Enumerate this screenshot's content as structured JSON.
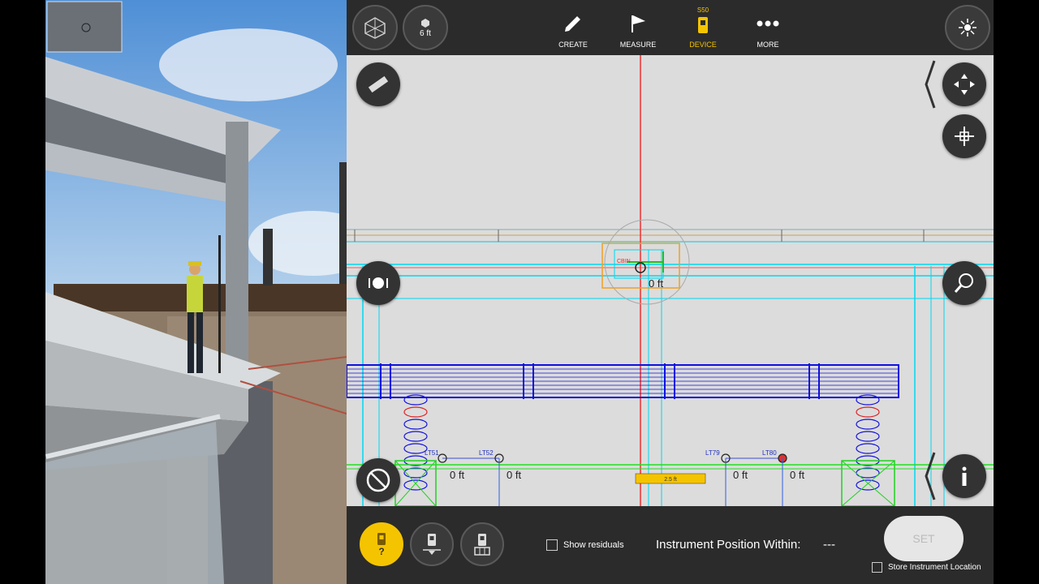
{
  "toolbar": {
    "scale_label": "6 ft",
    "create_label": "CREATE",
    "measure_label": "MEASURE",
    "device_label": "DEVICE",
    "device_badge": "S50",
    "more_label": "MORE",
    "accent_color": "#f5c400"
  },
  "canvas": {
    "center_offset_label": "0 ft",
    "offsets": [
      "0 ft",
      "0 ft",
      "0 ft",
      "0 ft"
    ],
    "scale_bar_label": "2.5 ft",
    "center_point_label": "CBIN",
    "point_labels": [
      "LT51",
      "LT52",
      "LT79",
      "LT80"
    ]
  },
  "bottom": {
    "show_residuals_label": "Show residuals",
    "instrument_position_label": "Instrument Position Within:",
    "instrument_position_value": "---",
    "set_label": "SET",
    "store_location_label": "Store Instrument Location",
    "device_help_mark": "?"
  },
  "icons": {
    "view_cube": "cube-icon",
    "ruler": "ruler-icon",
    "pan": "pan-arrows-icon",
    "zoom_extents": "crosshair-arrows-icon",
    "zoom": "magnifier-icon",
    "info": "info-icon",
    "cancel": "no-entry-icon",
    "brightness": "sun-icon"
  }
}
